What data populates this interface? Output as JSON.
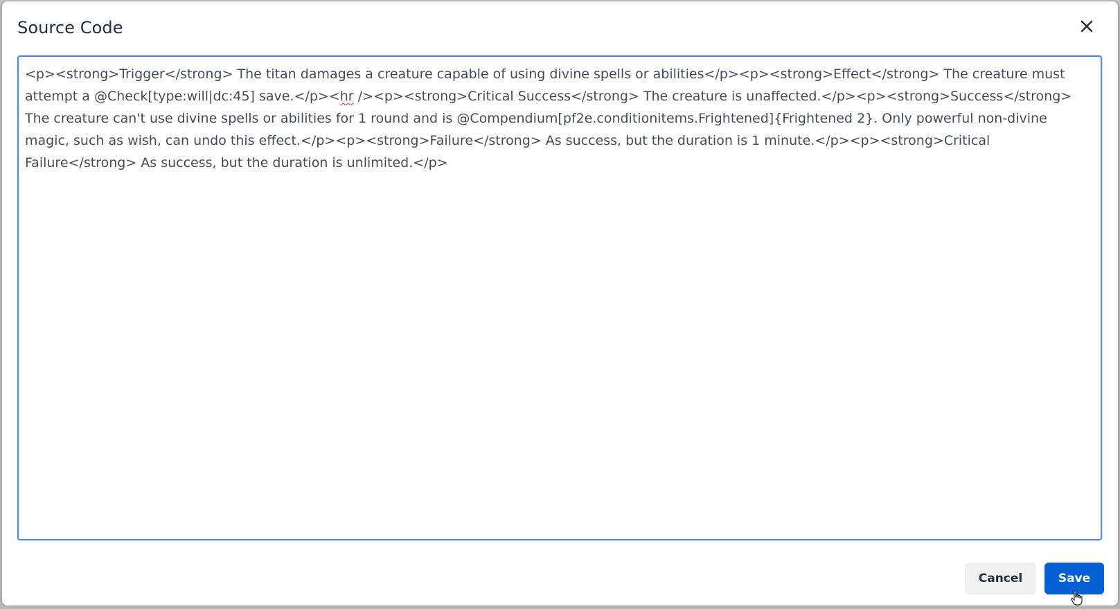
{
  "dialog": {
    "title": "Source Code",
    "close_icon": "close-icon",
    "source": {
      "segments": [
        {
          "text": "<p><strong>Trigger</strong> The titan damages a creature capable of using divine spells or abilities</p><p><strong>Effect</strong> The creature must attempt a @Check[type:will|dc:45] save.</p><",
          "spellcheck": false
        },
        {
          "text": "hr",
          "spellcheck": true
        },
        {
          "text": " /><p><strong>Critical Success</strong> The creature is unaffected.</p><p><strong>Success</strong> The creature can't use divine spells or abilities for 1 round and is @Compendium[pf2e.conditionitems.Frightened]{Frightened 2}. Only powerful non-divine magic, such as wish, can undo this effect.</p><p><strong>Failure</strong> As success, but the duration is 1 minute.</p><p><strong>Critical Failure</strong> As success, but the duration is unlimited.</p>",
          "spellcheck": false
        }
      ]
    },
    "footer": {
      "cancel_label": "Cancel",
      "save_label": "Save"
    }
  },
  "colors": {
    "primary": "#0560d4",
    "focus_border": "#4d8fdb",
    "title_text": "#222f3e",
    "body_text": "#444b55",
    "cancel_bg": "#f0f0f0",
    "overlay": "#b9b9b9"
  }
}
